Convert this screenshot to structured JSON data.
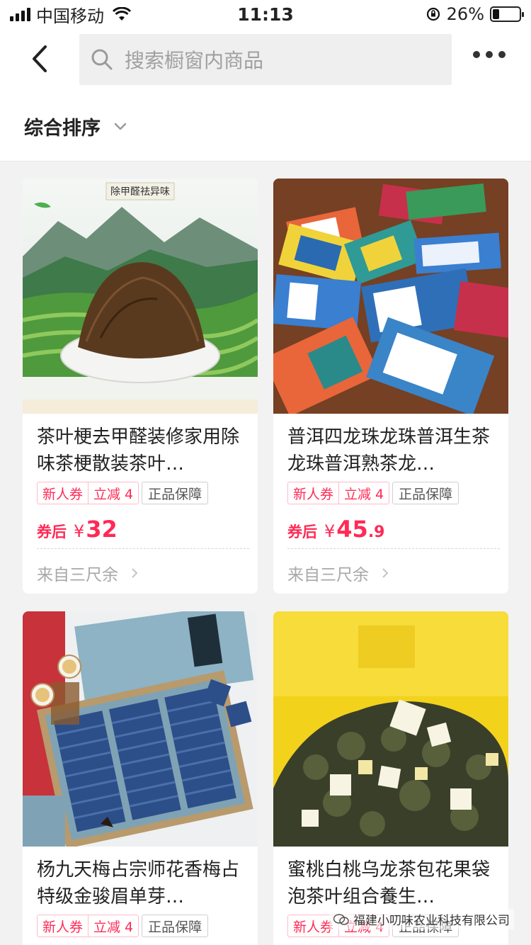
{
  "status_bar": {
    "carrier": "中国移动",
    "time": "11:13",
    "battery_percent": "26%",
    "battery_level": 0.26
  },
  "header": {
    "search_placeholder": "搜索橱窗内商品"
  },
  "sort": {
    "label": "综合排序"
  },
  "products": [
    {
      "title": "茶叶梗去甲醛装修家用除味茶梗散装茶叶…",
      "image_caption": "除甲醛祛异味",
      "coupon_new": "新人券",
      "coupon_off": "立减 4",
      "guarantee": "正品保障",
      "price_prefix": "券后",
      "currency": "¥",
      "price_int": "32",
      "price_dec": "",
      "source": "来自三尺余"
    },
    {
      "title": "普洱四龙珠龙珠普洱生茶龙珠普洱熟茶龙…",
      "coupon_new": "新人券",
      "coupon_off": "立减 4",
      "guarantee": "正品保障",
      "price_prefix": "券后",
      "currency": "¥",
      "price_int": "45",
      "price_dec": ".9",
      "source": "来自三尺余"
    },
    {
      "title": "杨九天梅占宗师花香梅占特级金骏眉单芽…",
      "coupon_new": "新人券",
      "coupon_off": "立减 4",
      "guarantee": "正品保障"
    },
    {
      "title": "蜜桃白桃乌龙茶包花果袋泡茶叶组合養生…",
      "coupon_new": "新人券",
      "coupon_off": "立减 4",
      "guarantee": "正品保障"
    }
  ],
  "watermark": "福建小叨味农业科技有限公司"
}
